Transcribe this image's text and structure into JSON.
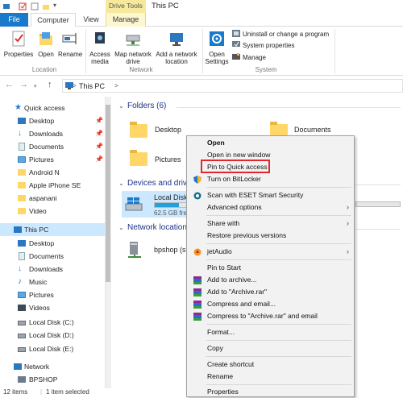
{
  "titlebar": {
    "context_tab": "Drive Tools",
    "title": "This PC"
  },
  "tabs": {
    "file": "File",
    "computer": "Computer",
    "view": "View",
    "manage": "Manage"
  },
  "ribbon": {
    "location": {
      "label": "Location",
      "properties": "Properties",
      "open": "Open",
      "rename": "Rename"
    },
    "network": {
      "label": "Network",
      "access_media": "Access media",
      "map_network_drive": "Map network drive",
      "add_network_location": "Add a network location"
    },
    "system": {
      "label": "System",
      "open_settings": "Open Settings",
      "uninstall": "Uninstall or change a program",
      "system_properties": "System properties",
      "manage": "Manage"
    }
  },
  "address": {
    "path": "This PC",
    "separator": ">"
  },
  "nav": {
    "quick_access": "Quick access",
    "quick_items": [
      "Desktop",
      "Downloads",
      "Documents",
      "Pictures",
      "Android N",
      "Apple iPhone SE",
      "aspanani",
      "Video"
    ],
    "this_pc": "This PC",
    "pc_items": [
      "Desktop",
      "Documents",
      "Downloads",
      "Music",
      "Pictures",
      "Videos",
      "Local Disk (C:)",
      "Local Disk (D:)",
      "Local Disk (E:)"
    ],
    "network": "Network",
    "network_items": [
      "BPSHOP"
    ]
  },
  "content": {
    "folders_heading": "Folders (6)",
    "folders": [
      "Desktop",
      "Documents",
      "Pictures"
    ],
    "devices_heading": "Devices and driv",
    "disk_name": "Local Disk (",
    "disk_free": "62.5 GB free",
    "disk_usage_fraction": 0.55,
    "network_heading": "Network location",
    "network_item": "bpshop (sh"
  },
  "status": {
    "count": "12 items",
    "selected": "1 item selected"
  },
  "context_menu": {
    "open": "Open",
    "open_new_window": "Open in new window",
    "pin_quick_access": "Pin to Quick access",
    "bitlocker": "Turn on BitLocker",
    "eset": "Scan with ESET Smart Security",
    "advanced": "Advanced options",
    "share_with": "Share with",
    "restore": "Restore previous versions",
    "jetaudio": "jetAudio",
    "pin_start": "Pin to Start",
    "add_archive": "Add to archive...",
    "add_rar": "Add to \"Archive.rar\"",
    "compress_email": "Compress and email...",
    "compress_rar_email": "Compress to \"Archive.rar\" and email",
    "format": "Format...",
    "copy": "Copy",
    "shortcut": "Create shortcut",
    "rename": "Rename",
    "properties": "Properties"
  },
  "colors": {
    "accent": "#1979ca",
    "selection": "#cce8ff",
    "drive_tools": "#f6e99b",
    "highlight_box": "#e3262e",
    "folder": "#ffd769"
  }
}
